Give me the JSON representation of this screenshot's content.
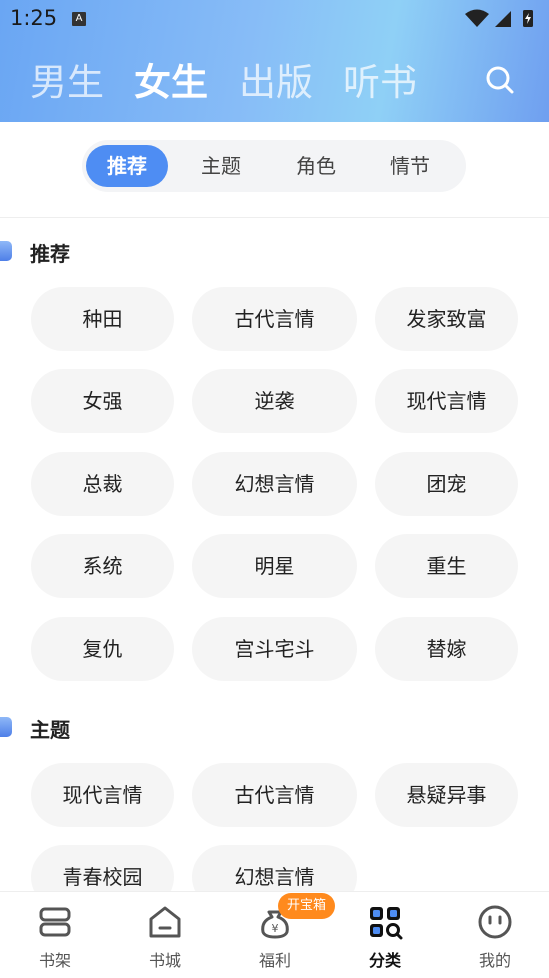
{
  "status": {
    "time": "1:25",
    "a_badge": "A"
  },
  "top_tabs": [
    "男生",
    "女生",
    "出版",
    "听书"
  ],
  "segments": [
    "推荐",
    "主题",
    "角色",
    "情节"
  ],
  "sections": [
    {
      "title": "推荐",
      "tags": [
        "种田",
        "古代言情",
        "发家致富",
        "女强",
        "逆袭",
        "现代言情",
        "总裁",
        "幻想言情",
        "团宠",
        "系统",
        "明星",
        "重生",
        "复仇",
        "宫斗宅斗",
        "替嫁"
      ]
    },
    {
      "title": "主题",
      "tags": [
        "现代言情",
        "古代言情",
        "悬疑异事",
        "青春校园",
        "幻想言情"
      ]
    }
  ],
  "bottom_nav": {
    "items": [
      "书架",
      "书城",
      "福利",
      "分类",
      "我的"
    ],
    "badge": "开宝箱"
  },
  "colors": {
    "accent": "#4e8df3",
    "badge": "#ff8a1d"
  }
}
